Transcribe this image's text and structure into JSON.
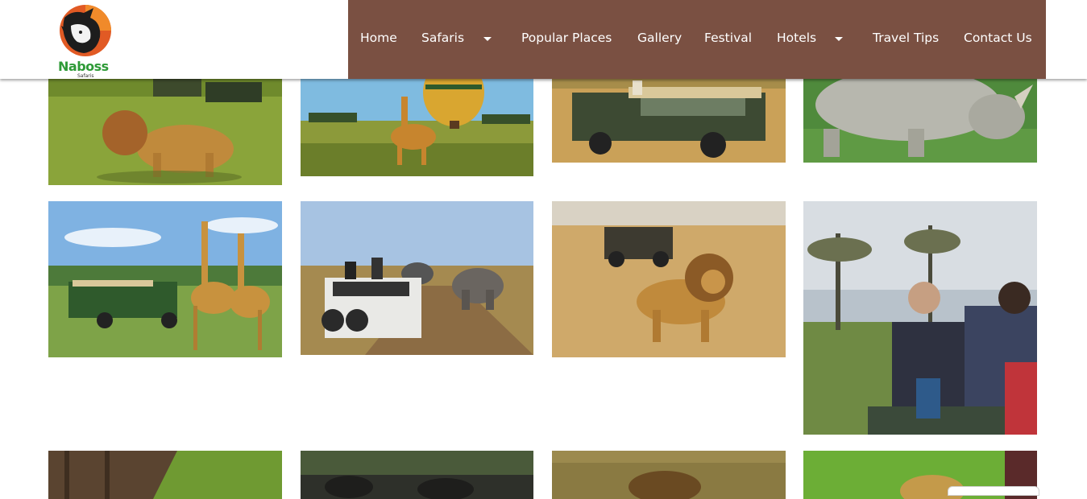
{
  "site": {
    "logo_name": "Naboss",
    "logo_sub": "Safaris"
  },
  "nav": {
    "items": [
      {
        "label": "Home",
        "dropdown": false
      },
      {
        "label": "Safaris",
        "dropdown": true
      },
      {
        "label": "Popular Places",
        "dropdown": false
      },
      {
        "label": "Gallery",
        "dropdown": false
      },
      {
        "label": "Festival",
        "dropdown": false
      },
      {
        "label": "Hotels",
        "dropdown": true
      },
      {
        "label": "Travel Tips",
        "dropdown": false
      },
      {
        "label": "Contact Us",
        "dropdown": false
      }
    ],
    "background_color": "#7a5042",
    "text_color": "#ffffff"
  },
  "gallery": {
    "photos": [
      {
        "subject": "lion-walking-grassland-safari-vehicles"
      },
      {
        "subject": "giraffe-hot-air-balloon"
      },
      {
        "subject": "green-safari-land-cruiser"
      },
      {
        "subject": "white-rhino"
      },
      {
        "subject": "giraffes-safari-vehicle"
      },
      {
        "subject": "safari-van-elephants-road"
      },
      {
        "subject": "male-lion-savanna-vehicle"
      },
      {
        "subject": "tourists-on-boat-lake"
      },
      {
        "subject": "tree-trunk-grass"
      },
      {
        "subject": "buffalo-herd-forest"
      },
      {
        "subject": "animal-in-grass"
      },
      {
        "subject": "leopard-green-background"
      }
    ]
  }
}
